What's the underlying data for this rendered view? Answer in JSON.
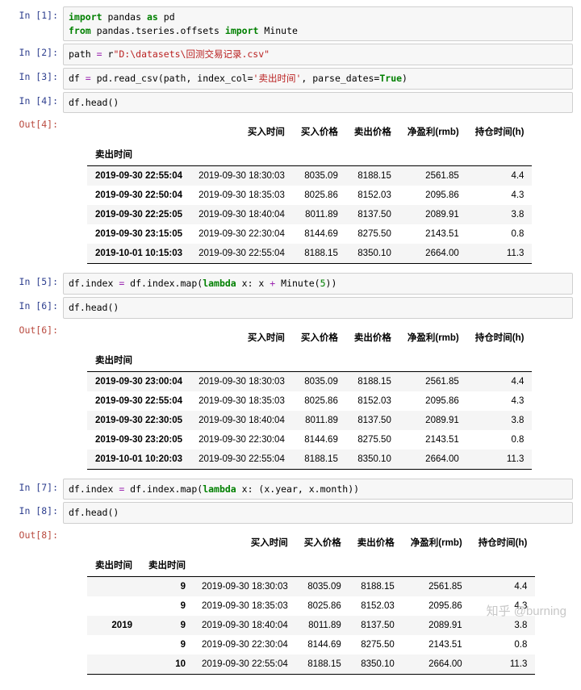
{
  "cells": {
    "in1": {
      "prompt": "In [1]:",
      "line1_kw1": "import",
      "line1_mod": "pandas",
      "line1_as": "as",
      "line1_alias": "pd",
      "line2_kw": "from",
      "line2_mod": "pandas.tseries.offsets",
      "line2_import": "import",
      "line2_name": "Minute"
    },
    "in2": {
      "prompt": "In [2]:",
      "var": "path",
      "eq": "=",
      "r": "r",
      "str": "\"D:\\datasets\\回测交易记录.csv\""
    },
    "in3": {
      "prompt": "In [3]:",
      "lhs": "df",
      "eq": "=",
      "call": "pd.read_csv(path, index_col=",
      "arg_str": "'卖出时间'",
      "mid": ", parse_dates=",
      "true": "True",
      "end": ")"
    },
    "in4": {
      "prompt": "In [4]:",
      "code": "df.head()"
    },
    "out4": {
      "prompt": "Out[4]:"
    },
    "in5": {
      "prompt": "In [5]:",
      "p1": "df.index ",
      "eq": "=",
      "p2": " df.index.map(",
      "lam": "lambda",
      "p3": " x: x ",
      "plus": "+",
      "p4": " Minute(",
      "n": "5",
      "p5": "))"
    },
    "in6": {
      "prompt": "In [6]:",
      "code": "df.head()"
    },
    "out6": {
      "prompt": "Out[6]:"
    },
    "in7": {
      "prompt": "In [7]:",
      "p1": "df.index ",
      "eq": "=",
      "p2": " df.index.map(",
      "lam": "lambda",
      "p3": " x: (x.year, x.month))"
    },
    "in8": {
      "prompt": "In [8]:",
      "code": "df.head()"
    },
    "out8": {
      "prompt": "Out[8]:"
    }
  },
  "table4": {
    "columns": [
      "买入时间",
      "买入价格",
      "卖出价格",
      "净盈利(rmb)",
      "持仓时间(h)"
    ],
    "index_name": "卖出时间",
    "rows": [
      {
        "idx": "2019-09-30 22:55:04",
        "c": [
          "2019-09-30 18:30:03",
          "8035.09",
          "8188.15",
          "2561.85",
          "4.4"
        ]
      },
      {
        "idx": "2019-09-30 22:50:04",
        "c": [
          "2019-09-30 18:35:03",
          "8025.86",
          "8152.03",
          "2095.86",
          "4.3"
        ]
      },
      {
        "idx": "2019-09-30 22:25:05",
        "c": [
          "2019-09-30 18:40:04",
          "8011.89",
          "8137.50",
          "2089.91",
          "3.8"
        ]
      },
      {
        "idx": "2019-09-30 23:15:05",
        "c": [
          "2019-09-30 22:30:04",
          "8144.69",
          "8275.50",
          "2143.51",
          "0.8"
        ]
      },
      {
        "idx": "2019-10-01 10:15:03",
        "c": [
          "2019-09-30 22:55:04",
          "8188.15",
          "8350.10",
          "2664.00",
          "11.3"
        ]
      }
    ]
  },
  "table6": {
    "columns": [
      "买入时间",
      "买入价格",
      "卖出价格",
      "净盈利(rmb)",
      "持仓时间(h)"
    ],
    "index_name": "卖出时间",
    "rows": [
      {
        "idx": "2019-09-30 23:00:04",
        "c": [
          "2019-09-30 18:30:03",
          "8035.09",
          "8188.15",
          "2561.85",
          "4.4"
        ]
      },
      {
        "idx": "2019-09-30 22:55:04",
        "c": [
          "2019-09-30 18:35:03",
          "8025.86",
          "8152.03",
          "2095.86",
          "4.3"
        ]
      },
      {
        "idx": "2019-09-30 22:30:05",
        "c": [
          "2019-09-30 18:40:04",
          "8011.89",
          "8137.50",
          "2089.91",
          "3.8"
        ]
      },
      {
        "idx": "2019-09-30 23:20:05",
        "c": [
          "2019-09-30 22:30:04",
          "8144.69",
          "8275.50",
          "2143.51",
          "0.8"
        ]
      },
      {
        "idx": "2019-10-01 10:20:03",
        "c": [
          "2019-09-30 22:55:04",
          "8188.15",
          "8350.10",
          "2664.00",
          "11.3"
        ]
      }
    ]
  },
  "table8": {
    "columns": [
      "买入时间",
      "买入价格",
      "卖出价格",
      "净盈利(rmb)",
      "持仓时间(h)"
    ],
    "index_names": [
      "卖出时间",
      "卖出时间"
    ],
    "rows": [
      {
        "i0": "",
        "i1": "9",
        "c": [
          "2019-09-30 18:30:03",
          "8035.09",
          "8188.15",
          "2561.85",
          "4.4"
        ]
      },
      {
        "i0": "",
        "i1": "9",
        "c": [
          "2019-09-30 18:35:03",
          "8025.86",
          "8152.03",
          "2095.86",
          "4.3"
        ]
      },
      {
        "i0": "2019",
        "i1": "9",
        "c": [
          "2019-09-30 18:40:04",
          "8011.89",
          "8137.50",
          "2089.91",
          "3.8"
        ]
      },
      {
        "i0": "",
        "i1": "9",
        "c": [
          "2019-09-30 22:30:04",
          "8144.69",
          "8275.50",
          "2143.51",
          "0.8"
        ]
      },
      {
        "i0": "",
        "i1": "10",
        "c": [
          "2019-09-30 22:55:04",
          "8188.15",
          "8350.10",
          "2664.00",
          "11.3"
        ]
      }
    ]
  },
  "watermark": "知乎 @burning"
}
